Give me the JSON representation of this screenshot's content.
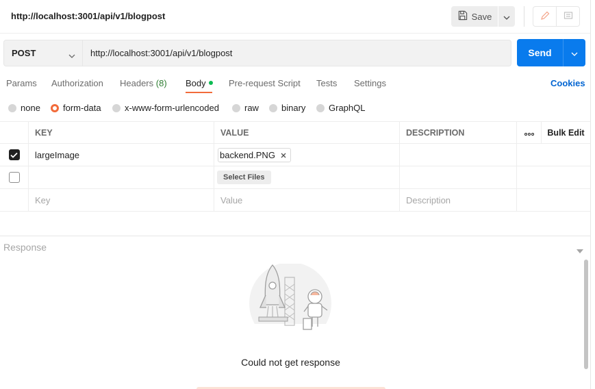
{
  "header": {
    "title": "http://localhost:3001/api/v1/blogpost",
    "save_label": "Save",
    "icons": [
      "save-icon",
      "chevron-down-icon",
      "pencil-icon",
      "comment-icon"
    ]
  },
  "request": {
    "method": "POST",
    "url": "http://localhost:3001/api/v1/blogpost",
    "send_label": "Send"
  },
  "tabs": [
    {
      "label": "Params"
    },
    {
      "label": "Authorization"
    },
    {
      "label": "Headers",
      "count": "(8)"
    },
    {
      "label": "Body",
      "active": true
    },
    {
      "label": "Pre-request Script"
    },
    {
      "label": "Tests"
    },
    {
      "label": "Settings"
    }
  ],
  "cookies_label": "Cookies",
  "body_types": [
    "none",
    "form-data",
    "x-www-form-urlencoded",
    "raw",
    "binary",
    "GraphQL"
  ],
  "body_type_selected": "form-data",
  "table": {
    "headers": {
      "key": "KEY",
      "value": "VALUE",
      "description": "DESCRIPTION",
      "bulk_edit": "Bulk Edit"
    },
    "rows": [
      {
        "checked": true,
        "key": "largeImage",
        "value_file": "backend.PNG",
        "description": ""
      },
      {
        "checked": false,
        "key": "",
        "select_files": "Select Files",
        "description": ""
      }
    ],
    "placeholders": {
      "key": "Key",
      "value": "Value",
      "description": "Description"
    }
  },
  "response": {
    "title": "Response",
    "message": "Could not get response"
  },
  "colors": {
    "accent": "#f26b3a",
    "send": "#097bed",
    "link": "#0265d2",
    "status_dot": "#0cbb52"
  }
}
